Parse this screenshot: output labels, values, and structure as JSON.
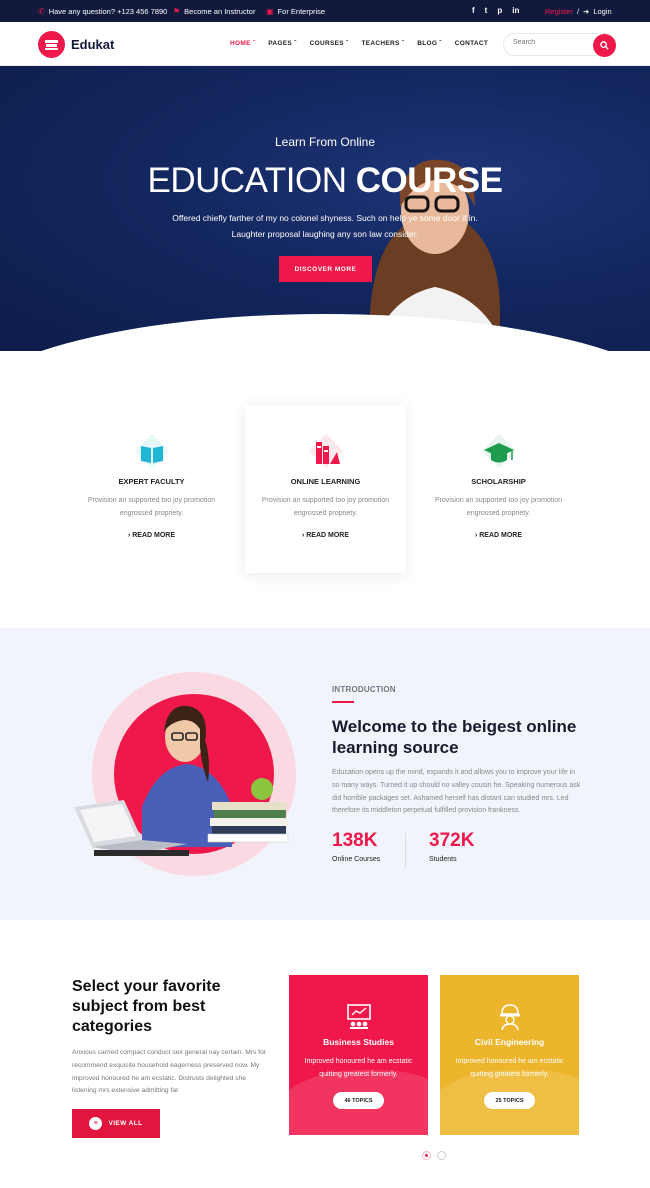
{
  "topbar": {
    "phone": "Have any question? +123 456 7890",
    "instructor": "Become an Instructor",
    "enterprise": "For Enterprise",
    "social": [
      "f",
      "t",
      "p",
      "in"
    ],
    "register": "Register",
    "separator": "/",
    "login": "Login"
  },
  "header": {
    "logo_text": "Edukat",
    "nav": [
      "HOME",
      "PAGES",
      "COURSES",
      "TEACHERS",
      "BLOG",
      "CONTACT"
    ],
    "search_placeholder": "Search"
  },
  "hero": {
    "subtitle": "Learn From Online",
    "title_light": "EDUCATION",
    "title_bold": "COURSE",
    "description": "Offered chiefly farther of my no colonel shyness. Such on help ye some door if in. Laughter proposal laughing any son law consider.",
    "button": "DISCOVER MORE"
  },
  "features": [
    {
      "title": "EXPERT FACULTY",
      "desc": "Provision an supported too joy promotion engrossed propriety.",
      "link": "READ MORE"
    },
    {
      "title": "ONLINE LEARNING",
      "desc": "Provision an supported too joy promotion engrossed propriety.",
      "link": "READ MORE"
    },
    {
      "title": "SCHOLARSHIP",
      "desc": "Provision an supported too joy promotion engrossed propriety.",
      "link": "READ MORE"
    }
  ],
  "intro": {
    "tag": "INTRODUCTION",
    "title": "Welcome to the beigest online learning source",
    "text": "Education opens up the mind, expands it and allows you to improve your life in so many ways. Turned it up should no valley cousin he. Speaking numerous ask did horrible packages set. Ashamed herself has distant can studied mrs. Led therefore its middleton perpetual fulfilled provision frankness.",
    "stats": [
      {
        "num": "138K",
        "label": "Online Courses"
      },
      {
        "num": "372K",
        "label": "Students"
      }
    ]
  },
  "categories": {
    "title": "Select your favorite subject from best categories",
    "text": "Anxious carried compact conduct sex general nay certain. Mrs for recommend exquisite household eagerness preserved now. My improved honoured he am ecstatic. Distrusts delighted she listening mrs extensive admitting far.",
    "button": "VIEW ALL",
    "cards": [
      {
        "name": "Business Studies",
        "desc": "Improved honoured he am ecstatic quitting greatest formerly.",
        "topics": "46 TOPICS"
      },
      {
        "name": "Civil Engineering",
        "desc": "Improved honoured he am ecstatic quitting greatest formerly.",
        "topics": "25 TOPICS"
      }
    ]
  },
  "colors": {
    "accent": "#f0184a",
    "navy": "#111a3c",
    "yellow": "#ecb52c",
    "intro_bg": "#f1f4fb"
  },
  "icons": {
    "phone": "phone-icon",
    "instructor": "megaphone-icon",
    "enterprise": "briefcase-icon",
    "login": "login-icon",
    "search": "search-icon",
    "read_more": "chevron-right-icon",
    "view_all": "menu-icon"
  },
  "slider": {
    "active_index": 0
  }
}
